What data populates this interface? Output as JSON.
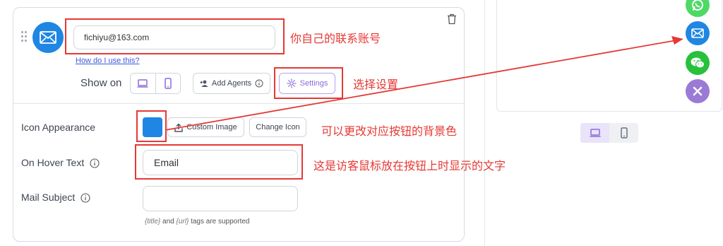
{
  "channel": {
    "email_value": "fichiyu@163.com",
    "help_link": "How do I use this?",
    "show_on_label": "Show on",
    "add_agents_label": "Add Agents",
    "settings_label": "Settings"
  },
  "appearance": {
    "label": "Icon Appearance",
    "color": "#1f86e3",
    "custom_image_label": "Custom Image",
    "change_icon_label": "Change Icon"
  },
  "hover_text": {
    "label": "On Hover Text",
    "value": "Email"
  },
  "mail_subject": {
    "label": "Mail Subject",
    "value": "",
    "note_title": "{title}",
    "note_and": "and",
    "note_url": "{url}",
    "note_rest": "tags are supported"
  },
  "annotations": {
    "account": "你自己的联系账号",
    "settings": "选择设置",
    "background": "可以更改对应按钮的背景色",
    "hover": "这是访客鼠标放在按钮上时显示的文字"
  },
  "preview": {
    "buttons": [
      {
        "icon": "whatsapp-icon",
        "color": "#4cd964"
      },
      {
        "icon": "email-icon",
        "color": "#1f86e3"
      },
      {
        "icon": "wechat-icon",
        "color": "#27c13c"
      },
      {
        "icon": "close-icon",
        "color": "#9b7ad6"
      }
    ]
  },
  "colors": {
    "accent_purple": "#8b6bd8",
    "annotation_red": "#e53935",
    "email_blue": "#1f86e3"
  }
}
